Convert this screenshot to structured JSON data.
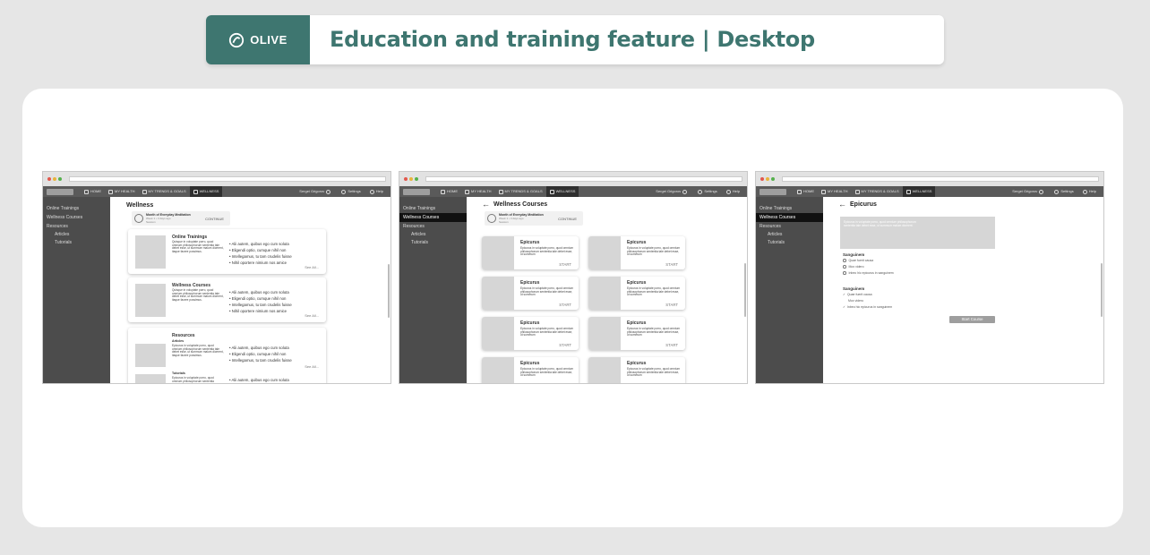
{
  "brand": {
    "name": "OLIVE",
    "accent": "#3e7670"
  },
  "banner": {
    "title": "Education and training feature | Desktop"
  },
  "app": {
    "nav": {
      "home": "HOME",
      "my_health": "MY HEALTH",
      "trends": "MY TRENDS & GOALS",
      "wellness": "WELLNESS",
      "user": "Sergei Grigorov",
      "settings": "Settings",
      "help": "Help"
    },
    "sidebar": {
      "online_trainings": "Online Trainings",
      "wellness_courses": "Wellness Courses",
      "resources": "Resources",
      "articles": "Articles",
      "tutorials": "Tutorials"
    },
    "continue_box": {
      "title": "Month of Everyday Meditation",
      "sub": "Week 1 • 3 days ago",
      "sub2": "Session",
      "action": "CONTINUE"
    }
  },
  "screen1": {
    "title": "Wellness",
    "cards": [
      {
        "title": "Online Trainings",
        "lorem": "Quisque in voluptate porro, quod omnium philosophorum sententia tale debet esse, ut summum malum dicerent, itaque facere possimus.",
        "bullets": [
          "Alii autem, quibus ego cum soluta",
          "Eligendi optio, cumque nihil non",
          "Intellegamus, tu tam crudelis fuisse",
          "Nihil oportere nimium nos amice"
        ],
        "see_all": "See All..."
      },
      {
        "title": "Wellness Courses",
        "lorem": "Quisque in voluptate porro, quod omnium philosophorum sententia tale debet esse, ut summum malum dicerent, itaque facere possimus.",
        "bullets": [
          "Alii autem, quibus ego cum soluta",
          "Eligendi optio, cumque nihil non",
          "Intellegamus, tu tam crudelis fuisse",
          "Nihil oportere nimium nos amice"
        ],
        "see_all": "See All..."
      },
      {
        "title": "Resources",
        "sub1": "Articles",
        "lorem": "Epicurus in voluptate porro, quod omnium philosophorum sententia tale debet esse, ut summum malum dicerent, itaque facere possimus.",
        "bullets": [
          "Alii autem, quibus ego cum soluta",
          "Eligendi optio, cumque nihil non",
          "Intellegamus, tu tam crudelis fuisse"
        ],
        "see_all": "See All...",
        "sub2": "Tutorials",
        "lorem2": "Epicurus in voluptate porro, quod omnium philosophorum sententia",
        "bullet2": "Alii autem, quibus ego cum soluta"
      }
    ]
  },
  "screen2": {
    "title": "Wellness Courses",
    "course_title": "Epicurus",
    "course_lorem": "Epicurus in voluptate porro, quod omnium philosophorum sententia tale debet esse, ut summum",
    "start": "START"
  },
  "screen3": {
    "title": "Epicurus",
    "player_text": "Epicurus in voluptate porro, quod omnium philosophorum sententia tale debet esse, ut summum malum dicerent.",
    "q1": {
      "heading": "Sanguinem",
      "options": [
        "Quae fuerit causa",
        "Mox videro",
        "Inbeo hic epicurus in sanguinem"
      ]
    },
    "q2": {
      "heading": "Sanguinem",
      "options": [
        "Quae fuerit causa",
        "Mox videro",
        "Inbeo hic epicurus in sanguinem"
      ]
    },
    "start_button": "Start Course"
  }
}
